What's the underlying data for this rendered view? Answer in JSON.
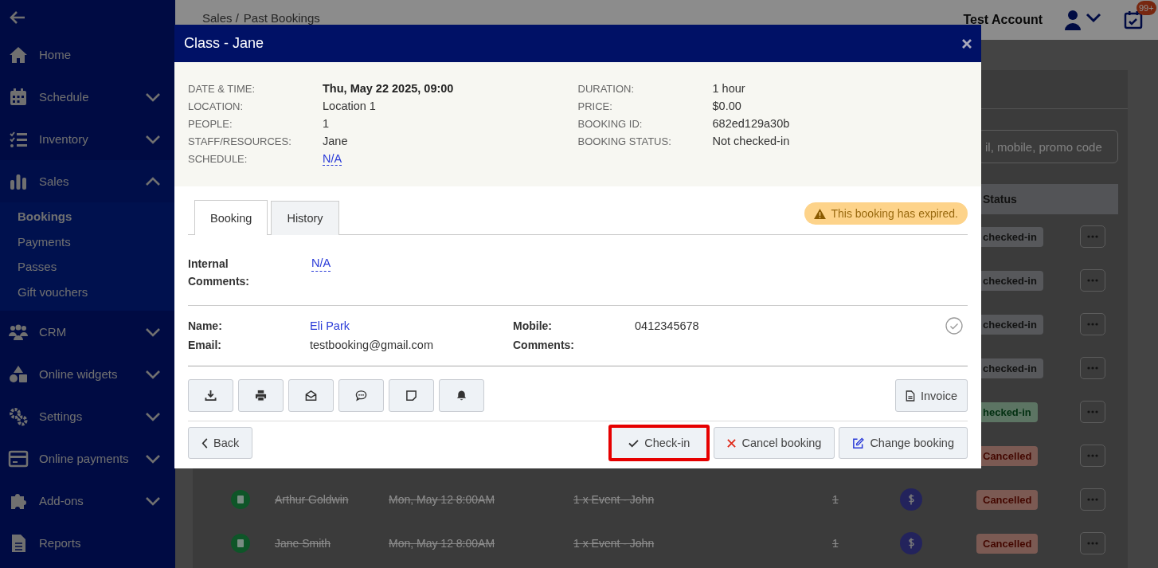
{
  "sidebar": {
    "items": [
      {
        "label": "Home"
      },
      {
        "label": "Schedule",
        "expanded": false
      },
      {
        "label": "Inventory",
        "expanded": false
      },
      {
        "label": "Sales",
        "expanded": true,
        "children": [
          {
            "label": "Bookings",
            "selected": true
          },
          {
            "label": "Payments",
            "selected": false
          },
          {
            "label": "Passes",
            "selected": false
          },
          {
            "label": "Gift vouchers",
            "selected": false
          }
        ]
      },
      {
        "label": "CRM",
        "expanded": false
      },
      {
        "label": "Online widgets",
        "expanded": false
      },
      {
        "label": "Settings",
        "expanded": false
      },
      {
        "label": "Online payments",
        "expanded": false
      },
      {
        "label": "Add-ons",
        "expanded": false
      },
      {
        "label": "Reports"
      }
    ]
  },
  "header": {
    "breadcrumb": [
      "Sales /",
      "Past Bookings"
    ],
    "account": "Test Account",
    "notification_badge": "99+"
  },
  "search": {
    "placeholder": "il, mobile, promo code"
  },
  "table": {
    "status_heading": "Status",
    "rows": [
      {
        "status": {
          "text": "checked-in",
          "kind": "neutral"
        }
      },
      {
        "status": {
          "text": "checked-in",
          "kind": "neutral"
        }
      },
      {
        "status": {
          "text": "checked-in",
          "kind": "neutral"
        }
      },
      {
        "status": {
          "text": "checked-in",
          "kind": "neutral"
        }
      },
      {
        "status": {
          "text": "hecked-in",
          "kind": "success"
        }
      },
      {
        "status": {
          "text": "Cancelled",
          "kind": "danger"
        }
      },
      {
        "name": "Arthur Goldwin",
        "date": "Mon, May 12 8:00AM",
        "item": "1 x Event - John",
        "qty": "1",
        "status": {
          "text": "Cancelled",
          "kind": "danger"
        }
      },
      {
        "name": "Jane Smith",
        "date": "Mon, May 12 8:00AM",
        "item": "1 x Event - John",
        "qty": "1",
        "status": {
          "text": "Cancelled",
          "kind": "danger"
        }
      }
    ]
  },
  "modal": {
    "title": "Class - Jane",
    "details_left": [
      {
        "label": "DATE & TIME:",
        "value": "Thu, May 22 2025, 09:00",
        "kind": "bold"
      },
      {
        "label": "LOCATION:",
        "value": "Location 1",
        "kind": "plain"
      },
      {
        "label": "PEOPLE:",
        "value": "1",
        "kind": "plain"
      },
      {
        "label": "STAFF/RESOURCES:",
        "value": "Jane",
        "kind": "plain"
      },
      {
        "label": "SCHEDULE:",
        "value": "N/A",
        "kind": "link"
      }
    ],
    "details_right": [
      {
        "label": "DURATION:",
        "value": "1 hour",
        "kind": "plain"
      },
      {
        "label": "PRICE:",
        "value": "$0.00",
        "kind": "plain"
      },
      {
        "label": "BOOKING ID:",
        "value": "682ed129a30b",
        "kind": "plain"
      },
      {
        "label": "BOOKING STATUS:",
        "value": "Not checked-in",
        "kind": "plain"
      }
    ],
    "tabs": [
      {
        "label": "Booking",
        "selected": true
      },
      {
        "label": "History",
        "selected": false
      }
    ],
    "alert": "This booking has expired.",
    "internal_comments": {
      "label": "Internal Comments:",
      "value": "N/A"
    },
    "contact": {
      "name_label": "Name:",
      "name": "Eli Park",
      "email_label": "Email:",
      "email": "testbooking@gmail.com",
      "mobile_label": "Mobile:",
      "mobile": "0412345678",
      "comments_label": "Comments:"
    },
    "invoice": "Invoice",
    "footer": [
      {
        "label": "Back",
        "kind": "back",
        "highlighted": false
      },
      {
        "label": "Check-in",
        "kind": "checkin",
        "highlighted": true
      },
      {
        "label": "Cancel booking",
        "kind": "cancel",
        "highlighted": false
      },
      {
        "label": "Change booking",
        "kind": "change",
        "highlighted": false
      }
    ]
  }
}
